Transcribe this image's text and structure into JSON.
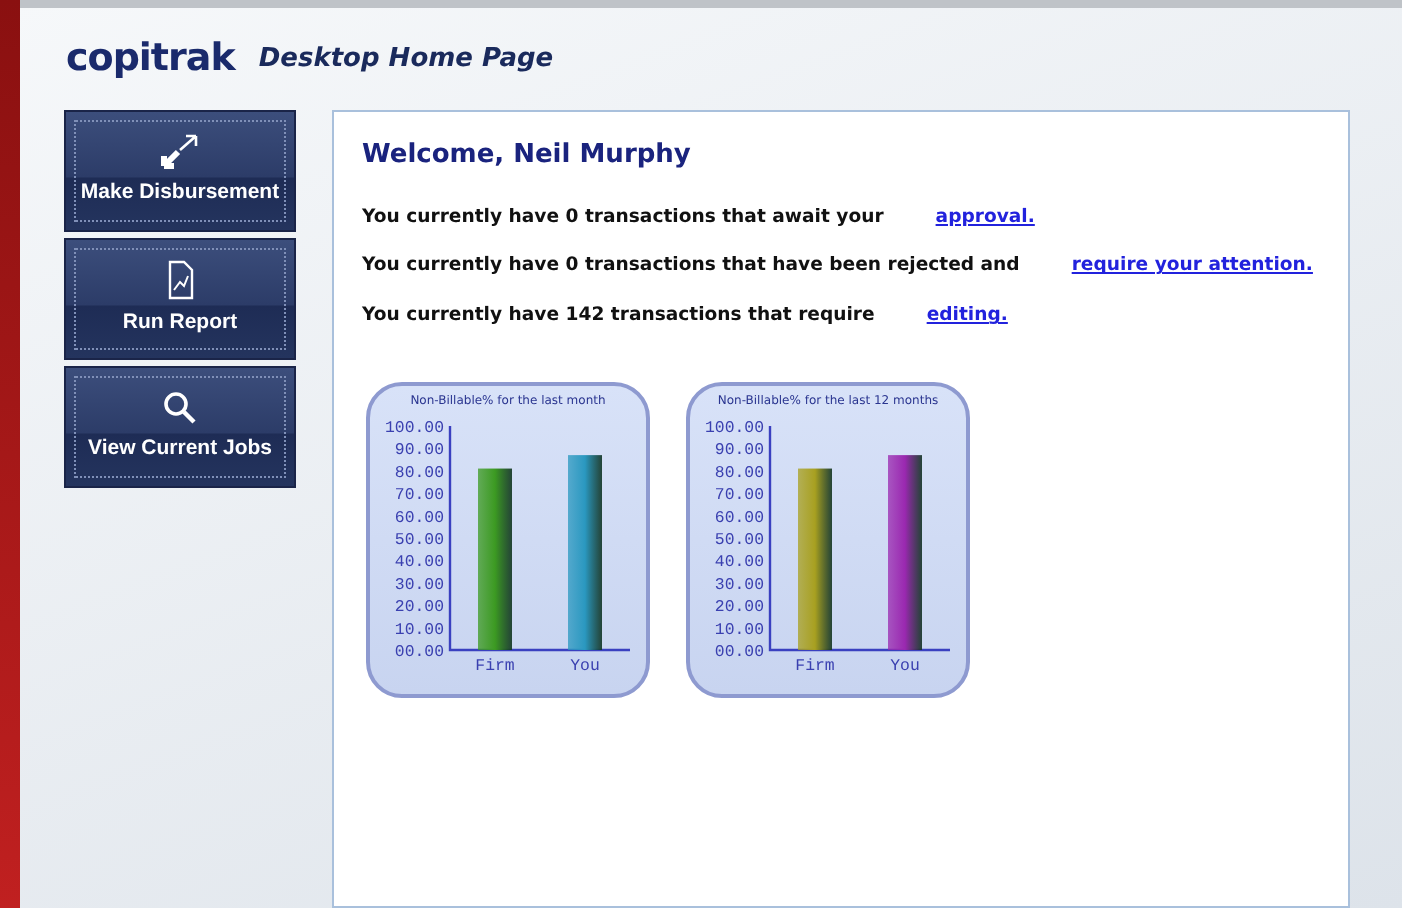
{
  "header": {
    "logo": "copitrak",
    "title": "Desktop Home Page"
  },
  "sidebar": {
    "items": [
      {
        "label": "Make Disbursement",
        "kind": "disburse"
      },
      {
        "label": "Run Report",
        "kind": "report"
      },
      {
        "label": "View Current Jobs",
        "kind": "jobs"
      }
    ]
  },
  "welcome": "Welcome, Neil Murphy",
  "messages": [
    {
      "text": "You currently have 0 transactions that await your",
      "link": "approval."
    },
    {
      "text": "You currently have 0 transactions that have been rejected and",
      "link": "require your attention."
    },
    {
      "text": "You currently have 142 transactions that require",
      "link": "editing."
    }
  ],
  "charts": [
    {
      "chart_data": {
        "type": "bar",
        "title": "Non-Billable% for the last month",
        "series": [
          {
            "name": "Firm",
            "color": "#3c9a22",
            "values": [
              81,
              null
            ]
          },
          {
            "name": "You",
            "color": "#2a98c0",
            "values": [
              null,
              87
            ]
          }
        ],
        "ylim": [
          0,
          100
        ],
        "yticks": [
          {
            "value": 0,
            "label": "00.00"
          },
          {
            "value": 10,
            "label": "10.00"
          },
          {
            "value": 20,
            "label": "20.00"
          },
          {
            "value": 30,
            "label": "30.00"
          },
          {
            "value": 40,
            "label": "40.00"
          },
          {
            "value": 50,
            "label": "50.00"
          },
          {
            "value": 60,
            "label": "60.00"
          },
          {
            "value": 70,
            "label": "70.00"
          },
          {
            "value": 80,
            "label": "80.00"
          },
          {
            "value": 90,
            "label": "90.00"
          },
          {
            "value": 100,
            "label": "100.00"
          }
        ]
      }
    },
    {
      "chart_data": {
        "type": "bar",
        "title": "Non-Billable% for the last 12 months",
        "series": [
          {
            "name": "Firm",
            "color": "#a8a020",
            "values": [
              81,
              null
            ]
          },
          {
            "name": "You",
            "color": "#9a28b0",
            "values": [
              null,
              87
            ]
          }
        ],
        "ylim": [
          0,
          100
        ],
        "yticks": [
          {
            "value": 0,
            "label": "00.00"
          },
          {
            "value": 10,
            "label": "10.00"
          },
          {
            "value": 20,
            "label": "20.00"
          },
          {
            "value": 30,
            "label": "30.00"
          },
          {
            "value": 40,
            "label": "40.00"
          },
          {
            "value": 50,
            "label": "50.00"
          },
          {
            "value": 60,
            "label": "60.00"
          },
          {
            "value": 70,
            "label": "70.00"
          },
          {
            "value": 80,
            "label": "80.00"
          },
          {
            "value": 90,
            "label": "90.00"
          },
          {
            "value": 100,
            "label": "100.00"
          }
        ]
      }
    }
  ]
}
